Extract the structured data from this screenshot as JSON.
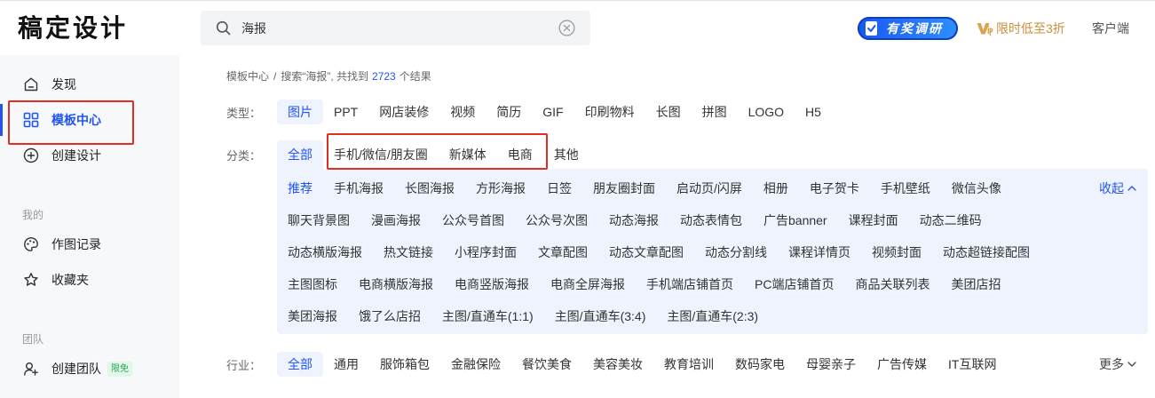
{
  "header": {
    "logo": "稿定设计",
    "search": {
      "value": "海报",
      "icon": "search-icon",
      "clear_icon": "clear-icon"
    },
    "survey_badge": "有奖调研",
    "vip_promo": "限时低至3折",
    "client_link": "客户端"
  },
  "sidebar": {
    "main_items": [
      {
        "label": "发现",
        "icon": "home-icon"
      },
      {
        "label": "模板中心",
        "icon": "grid-icon",
        "active": true
      },
      {
        "label": "创建设计",
        "icon": "plus-circle-icon"
      }
    ],
    "section_mine": "我的",
    "mine_items": [
      {
        "label": "作图记录",
        "icon": "palette-icon"
      },
      {
        "label": "收藏夹",
        "icon": "star-icon"
      }
    ],
    "section_team": "团队",
    "team_items": [
      {
        "label": "创建团队",
        "icon": "team-add-icon",
        "badge": "限免"
      }
    ]
  },
  "breadcrumb": {
    "root": "模板中心",
    "separator": "/",
    "query_text": "搜索“海报”, 共找到",
    "count": "2723",
    "suffix": "个结果"
  },
  "filters": {
    "type": {
      "label": "类型：",
      "active_index": 0,
      "options": [
        "图片",
        "PPT",
        "网店装修",
        "视频",
        "简历",
        "GIF",
        "印刷物料",
        "长图",
        "拼图",
        "LOGO",
        "H5"
      ]
    },
    "category": {
      "label": "分类：",
      "active_index": 0,
      "options": [
        "全部",
        "手机/微信/朋友圈",
        "新媒体",
        "电商",
        "其他"
      ],
      "sub": {
        "collapse_label": "收起",
        "rows": [
          [
            "推荐",
            "手机海报",
            "长图海报",
            "方形海报",
            "日签",
            "朋友圈封面",
            "启动页/闪屏",
            "相册",
            "电子贺卡",
            "手机壁纸",
            "微信头像"
          ],
          [
            "聊天背景图",
            "漫画海报",
            "公众号首图",
            "公众号次图",
            "动态海报",
            "动态表情包",
            "广告banner",
            "课程封面",
            "动态二维码"
          ],
          [
            "动态横版海报",
            "热文链接",
            "小程序封面",
            "文章配图",
            "动态文章配图",
            "动态分割线",
            "课程详情页",
            "视频封面",
            "动态超链接配图"
          ],
          [
            "主图图标",
            "电商横版海报",
            "电商竖版海报",
            "电商全屏海报",
            "手机端店铺首页",
            "PC端店铺首页",
            "商品关联列表",
            "美团店招"
          ],
          [
            "美团海报",
            "饿了么店招",
            "主图/直通车(1:1)",
            "主图/直通车(3:4)",
            "主图/直通车(2:3)"
          ]
        ]
      }
    },
    "industry": {
      "label": "行业：",
      "active_index": 0,
      "options": [
        "全部",
        "通用",
        "服饰箱包",
        "金融保险",
        "餐饮美食",
        "美容美妆",
        "教育培训",
        "数码家电",
        "母婴亲子",
        "广告传媒",
        "IT互联网"
      ],
      "more_label": "更多"
    }
  },
  "colors": {
    "accent": "#2254f4",
    "annotation_red": "#e02e24",
    "vip_gold": "#c8913a",
    "free_badge_green": "#1fa855",
    "panel_bg": "#eef3fe",
    "sidebar_bg": "#f7f8fa"
  }
}
